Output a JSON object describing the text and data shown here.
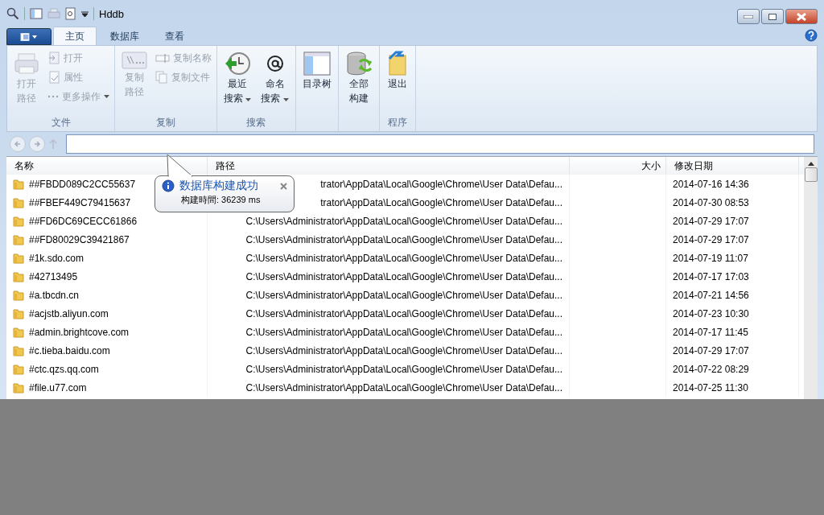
{
  "window": {
    "title": "Hddb"
  },
  "tabs": [
    {
      "label": "主页",
      "selected": true
    },
    {
      "label": "数据库",
      "selected": false
    },
    {
      "label": "查看",
      "selected": false
    }
  ],
  "ribbon": [
    {
      "label": "文件",
      "items": [
        {
          "kind": "large",
          "lines": [
            "打开",
            "路径"
          ],
          "disabled": true,
          "dropdown": false
        },
        {
          "kind": "small",
          "lines": [
            "打开"
          ],
          "disabled": true,
          "dropdown": false
        },
        {
          "kind": "small",
          "lines": [
            "属性"
          ],
          "disabled": true,
          "dropdown": false
        },
        {
          "kind": "small",
          "lines": [
            "更多操作"
          ],
          "disabled": true,
          "dropdown": true
        }
      ]
    },
    {
      "label": "复制",
      "items": [
        {
          "kind": "large",
          "lines": [
            "复制",
            "路径"
          ],
          "disabled": true,
          "dropdown": false
        },
        {
          "kind": "small",
          "lines": [
            "复制名称"
          ],
          "disabled": true,
          "dropdown": false
        },
        {
          "kind": "small",
          "lines": [
            "复制文件"
          ],
          "disabled": true,
          "dropdown": false
        }
      ]
    },
    {
      "label": "搜索",
      "items": [
        {
          "kind": "large",
          "lines": [
            "最近",
            "搜索"
          ],
          "disabled": false,
          "dropdown": true
        },
        {
          "kind": "large",
          "lines": [
            "命名",
            "搜索"
          ],
          "disabled": false,
          "dropdown": true
        }
      ]
    },
    {
      "items": [
        {
          "kind": "large",
          "lines": [
            "目录树"
          ],
          "disabled": false,
          "dropdown": false
        }
      ]
    },
    {
      "items": [
        {
          "kind": "large",
          "lines": [
            "全部",
            "构建"
          ],
          "disabled": false,
          "dropdown": false
        }
      ]
    },
    {
      "label": "程序",
      "items": [
        {
          "kind": "large",
          "lines": [
            "退出"
          ],
          "disabled": false,
          "dropdown": false
        }
      ]
    }
  ],
  "columns": [
    {
      "label": "名称"
    },
    {
      "label": "路径"
    },
    {
      "label": "大小"
    },
    {
      "label": "修改日期"
    }
  ],
  "rows": [
    {
      "name": "##FBDD089C2CC55637",
      "path": "trator\\AppData\\Local\\Google\\Chrome\\User Data\\Defau...",
      "date": "2014-07-16 14:36"
    },
    {
      "name": "##FBEF449C79415637",
      "path": "trator\\AppData\\Local\\Google\\Chrome\\User Data\\Defau...",
      "date": "2014-07-30 08:53"
    },
    {
      "name": "##FD6DC69CECC61866",
      "path": "C:\\Users\\Administrator\\AppData\\Local\\Google\\Chrome\\User Data\\Defau...",
      "date": "2014-07-29 17:07"
    },
    {
      "name": "##FD80029C39421867",
      "path": "C:\\Users\\Administrator\\AppData\\Local\\Google\\Chrome\\User Data\\Defau...",
      "date": "2014-07-29 17:07"
    },
    {
      "name": "#1k.sdo.com",
      "path": "C:\\Users\\Administrator\\AppData\\Local\\Google\\Chrome\\User Data\\Defau...",
      "date": "2014-07-19 11:07"
    },
    {
      "name": "#42713495",
      "path": "C:\\Users\\Administrator\\AppData\\Local\\Google\\Chrome\\User Data\\Defau...",
      "date": "2014-07-17 17:03"
    },
    {
      "name": "#a.tbcdn.cn",
      "path": "C:\\Users\\Administrator\\AppData\\Local\\Google\\Chrome\\User Data\\Defau...",
      "date": "2014-07-21 14:56"
    },
    {
      "name": "#acjstb.aliyun.com",
      "path": "C:\\Users\\Administrator\\AppData\\Local\\Google\\Chrome\\User Data\\Defau...",
      "date": "2014-07-23 10:30"
    },
    {
      "name": "#admin.brightcove.com",
      "path": "C:\\Users\\Administrator\\AppData\\Local\\Google\\Chrome\\User Data\\Defau...",
      "date": "2014-07-17 11:45"
    },
    {
      "name": "#c.tieba.baidu.com",
      "path": "C:\\Users\\Administrator\\AppData\\Local\\Google\\Chrome\\User Data\\Defau...",
      "date": "2014-07-29 17:07"
    },
    {
      "name": "#ctc.qzs.qq.com",
      "path": "C:\\Users\\Administrator\\AppData\\Local\\Google\\Chrome\\User Data\\Defau...",
      "date": "2014-07-22 08:29"
    },
    {
      "name": "#file.u77.com",
      "path": "C:\\Users\\Administrator\\AppData\\Local\\Google\\Chrome\\User Data\\Defau...",
      "date": "2014-07-25 11:30"
    }
  ],
  "notification": {
    "title": "数据库构建成功",
    "text": "构建時間: 36239 ms"
  }
}
